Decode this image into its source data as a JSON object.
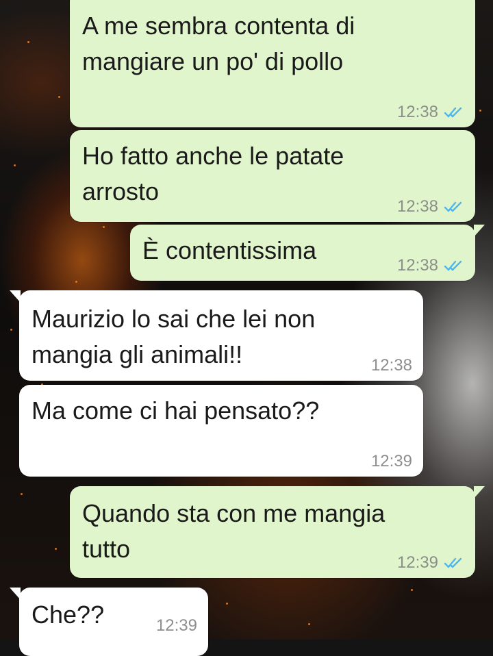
{
  "chat": {
    "messages": [
      {
        "direction": "outgoing",
        "text": "A me sembra contenta di\nmangiare un po' di pollo",
        "time": "12:38",
        "status": "read"
      },
      {
        "direction": "outgoing",
        "text": "Ho fatto anche le patate\narrosto",
        "time": "12:38",
        "status": "read"
      },
      {
        "direction": "outgoing",
        "text": "È contentissima",
        "time": "12:38",
        "status": "read"
      },
      {
        "direction": "incoming",
        "text": "Maurizio lo sai che lei non\nmangia gli animali!!",
        "time": "12:38"
      },
      {
        "direction": "incoming",
        "text": "Ma come ci hai pensato??",
        "time": "12:39"
      },
      {
        "direction": "outgoing",
        "text": "Quando sta con me mangia\ntutto",
        "time": "12:39",
        "status": "read"
      },
      {
        "direction": "incoming",
        "text": "Che??",
        "time": "12:39"
      }
    ]
  },
  "colors": {
    "outgoing_bubble": "#e1f5cd",
    "incoming_bubble": "#ffffff",
    "read_ticks": "#4fb6ec"
  },
  "icons": {
    "read_status": "double-check-icon"
  }
}
